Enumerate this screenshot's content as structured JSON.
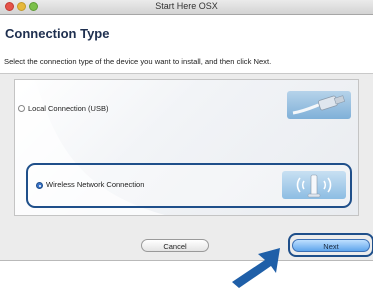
{
  "window": {
    "title": "Start Here OSX"
  },
  "header": {
    "title": "Connection Type",
    "instruction": "Select the connection type of the device you want to install, and then click Next."
  },
  "options": [
    {
      "label": "Local Connection (USB)",
      "selected": false,
      "icon": "usb-cable-icon"
    },
    {
      "label": "Wireless Network Connection",
      "selected": true,
      "icon": "wireless-router-icon"
    }
  ],
  "buttons": {
    "cancel": "Cancel",
    "next": "Next"
  },
  "colors": {
    "accent": "#1f4f8a",
    "header_title": "#1e2f4f",
    "next_button": "#5fa5ec"
  }
}
